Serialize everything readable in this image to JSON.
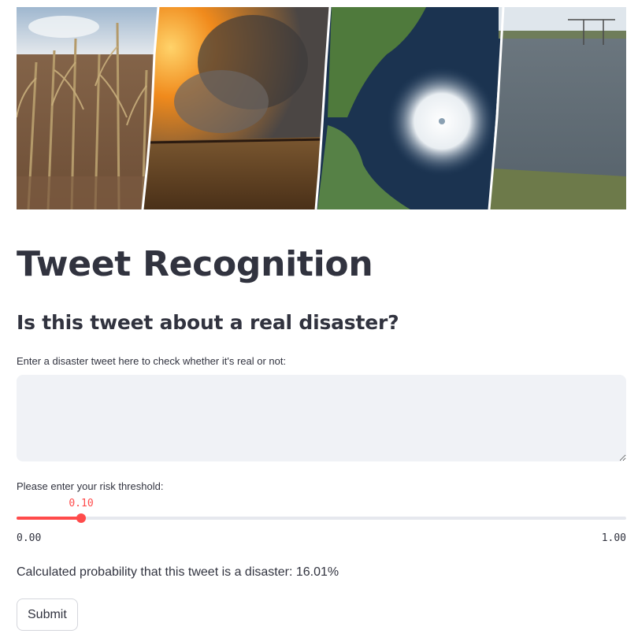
{
  "header": {
    "title": "Tweet Recognition",
    "subtitle": "Is this tweet about a real disaster?"
  },
  "hero": {
    "panels": [
      "drought-cornfield-photo",
      "wildfire-smoke-photo",
      "hurricane-satellite-photo",
      "flood-water-photo"
    ]
  },
  "tweet_input": {
    "label": "Enter a disaster tweet here to check whether it's real or not:",
    "value": "",
    "placeholder": ""
  },
  "threshold": {
    "label": "Please enter your risk threshold:",
    "value": 0.1,
    "value_text": "0.10",
    "min_text": "0.00",
    "max_text": "1.00",
    "accent": "#ff4b4b"
  },
  "result": {
    "text": "Calculated probability that this tweet is a disaster: 16.01%"
  },
  "submit": {
    "label": "Submit"
  }
}
